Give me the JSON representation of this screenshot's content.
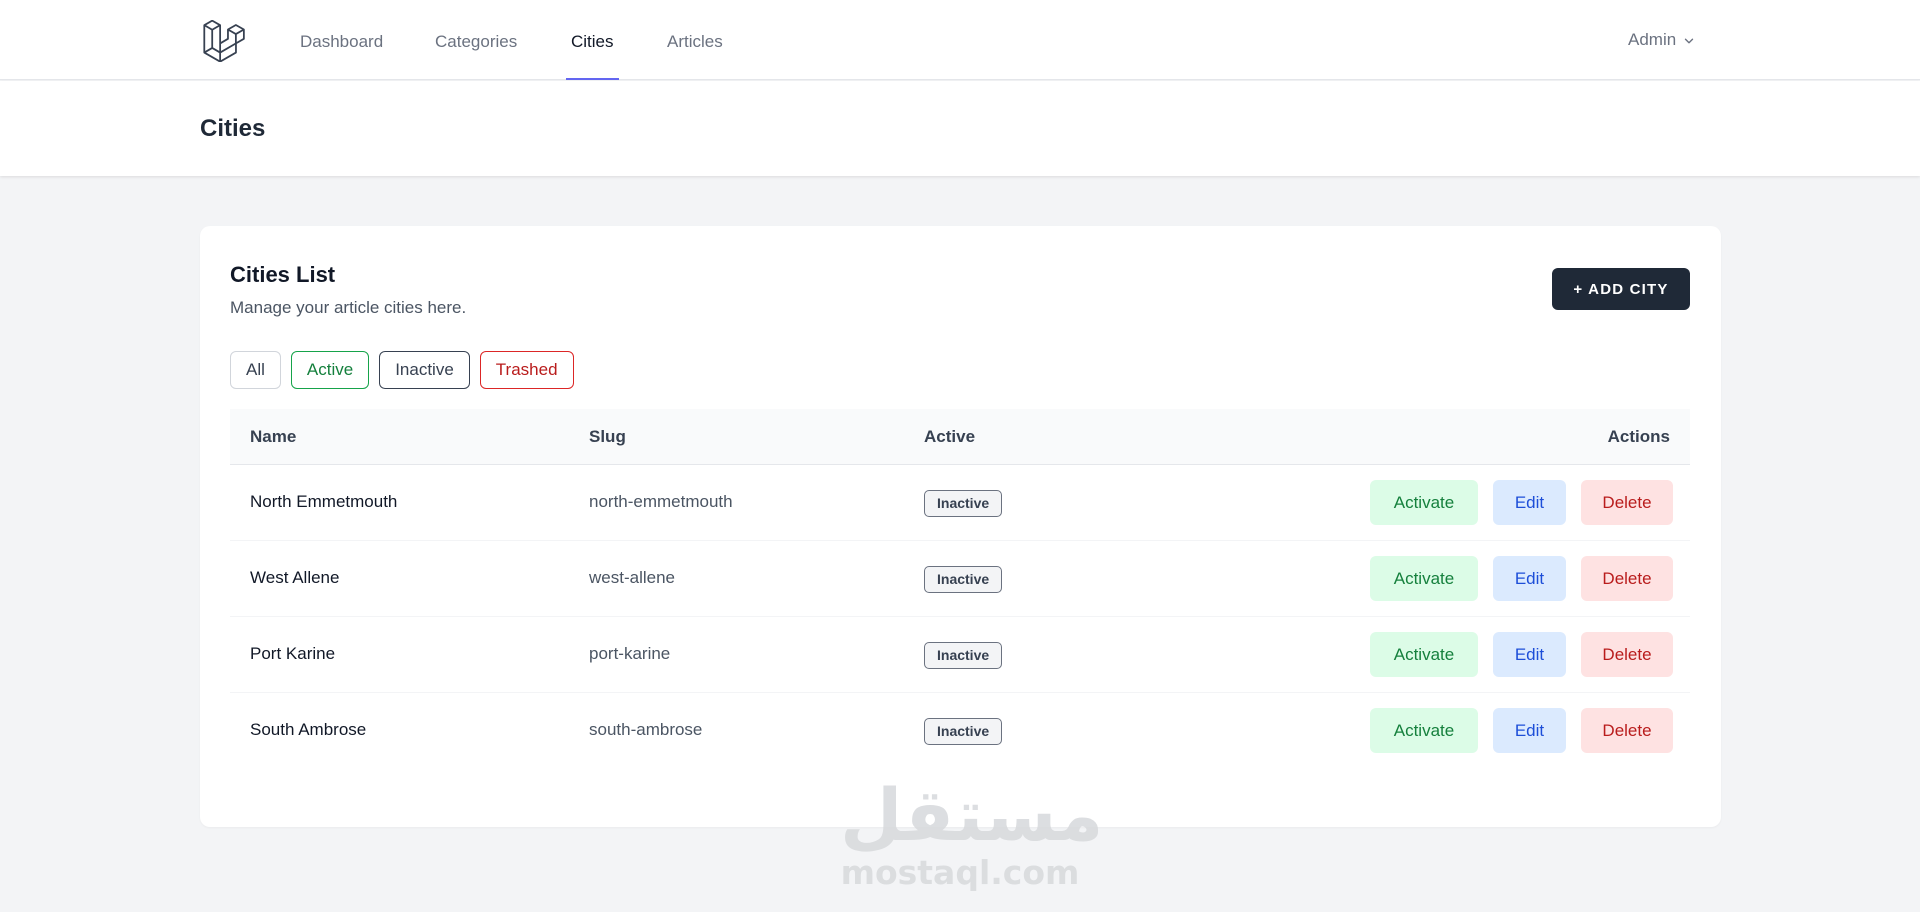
{
  "nav": {
    "logo_icon": "laravel-logo-icon",
    "links": [
      "Dashboard",
      "Categories",
      "Cities",
      "Articles"
    ],
    "active_link": "Cities",
    "user_name": "Admin",
    "user_chevron_icon": "chevron-down-icon"
  },
  "header": {
    "title": "Cities"
  },
  "card": {
    "title": "Cities List",
    "subtitle": "Manage your article cities here.",
    "add_button_label": "+ ADD CITY"
  },
  "filters": [
    "All",
    "Active",
    "Inactive",
    "Trashed"
  ],
  "table": {
    "columns": [
      "Name",
      "Slug",
      "Active",
      "Actions"
    ],
    "rows": [
      {
        "name": "North Emmetmouth",
        "slug": "north-emmetmouth",
        "status": "Inactive"
      },
      {
        "name": "West Allene",
        "slug": "west-allene",
        "status": "Inactive"
      },
      {
        "name": "Port Karine",
        "slug": "port-karine",
        "status": "Inactive"
      },
      {
        "name": "South Ambrose",
        "slug": "south-ambrose",
        "status": "Inactive"
      }
    ],
    "row_actions": {
      "activate": "Activate",
      "edit": "Edit",
      "delete": "Delete"
    }
  },
  "watermark": {
    "arabic": "مستقل",
    "latin": "mostaql.com"
  },
  "colors": {
    "accent": "#6366f1",
    "primary_button": "#1f2937",
    "activate_bg": "#dcfce7",
    "edit_bg": "#dbeafe",
    "delete_bg": "#fee2e2"
  }
}
